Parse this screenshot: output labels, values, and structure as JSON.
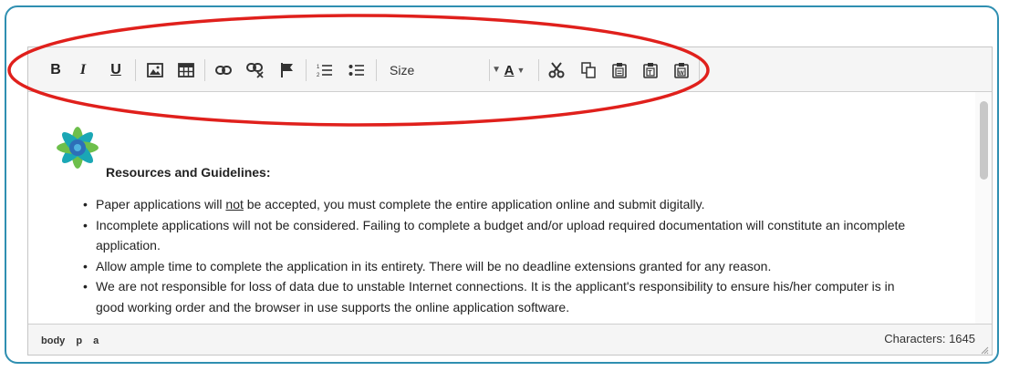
{
  "toolbar": {
    "bold_label": "B",
    "italic_label": "I",
    "underline_label": "U",
    "size_label": "Size",
    "font_color_label": "A",
    "icons": [
      "bold",
      "italic",
      "underline",
      "image-icon",
      "table-icon",
      "link-icon",
      "unlink-icon",
      "anchor-flag-icon",
      "numbered-list-icon",
      "bulleted-list-icon",
      "font-color-icon",
      "cut-icon",
      "copy-icon",
      "paste-icon",
      "paste-text-icon",
      "paste-word-icon"
    ]
  },
  "content": {
    "heading": "Resources and Guidelines:",
    "bullets": [
      {
        "pre": "Paper applications will ",
        "emph": "not",
        "post": " be accepted, you must complete the entire application online and submit digitally."
      },
      {
        "pre": "Incomplete applications will not be considered. Failing to complete a budget and/or upload required documentation will constitute an incomplete application.",
        "emph": "",
        "post": ""
      },
      {
        "pre": "Allow ample time to complete the application in its entirety. There will be no deadline extensions granted for any reason.",
        "emph": "",
        "post": ""
      },
      {
        "pre": "We are not responsible for loss of data due to unstable Internet connections. It is the applicant's responsibility to ensure his/her computer is in good working order and the browser in use supports the online application software.",
        "emph": "",
        "post": ""
      }
    ]
  },
  "status": {
    "path": [
      "body",
      "p",
      "a"
    ],
    "characters": "Characters: 1645"
  },
  "colors": {
    "frame": "#2f8fb1",
    "annotation": "#e0201c",
    "logo_green": "#6dbf4b",
    "logo_teal": "#1aa7b5",
    "logo_blue": "#2d6fb8"
  }
}
